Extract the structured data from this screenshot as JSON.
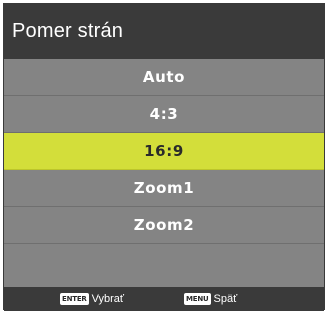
{
  "title": "Pomer strán",
  "menu": {
    "items": [
      {
        "label": "Auto"
      },
      {
        "label": "4:3"
      },
      {
        "label": "16:9",
        "selected": true
      },
      {
        "label": "Zoom1"
      },
      {
        "label": "Zoom2"
      },
      {
        "label": ""
      }
    ]
  },
  "footer": {
    "enter": {
      "key": "ENTER",
      "label": "Vybrať"
    },
    "menu": {
      "key": "MENU",
      "label": "Späť"
    }
  },
  "colors": {
    "title_bg": "#3a3a3a",
    "menu_bg": "#848484",
    "selected_bg": "#d3de3a",
    "footer_bg": "#3a3a3a"
  }
}
